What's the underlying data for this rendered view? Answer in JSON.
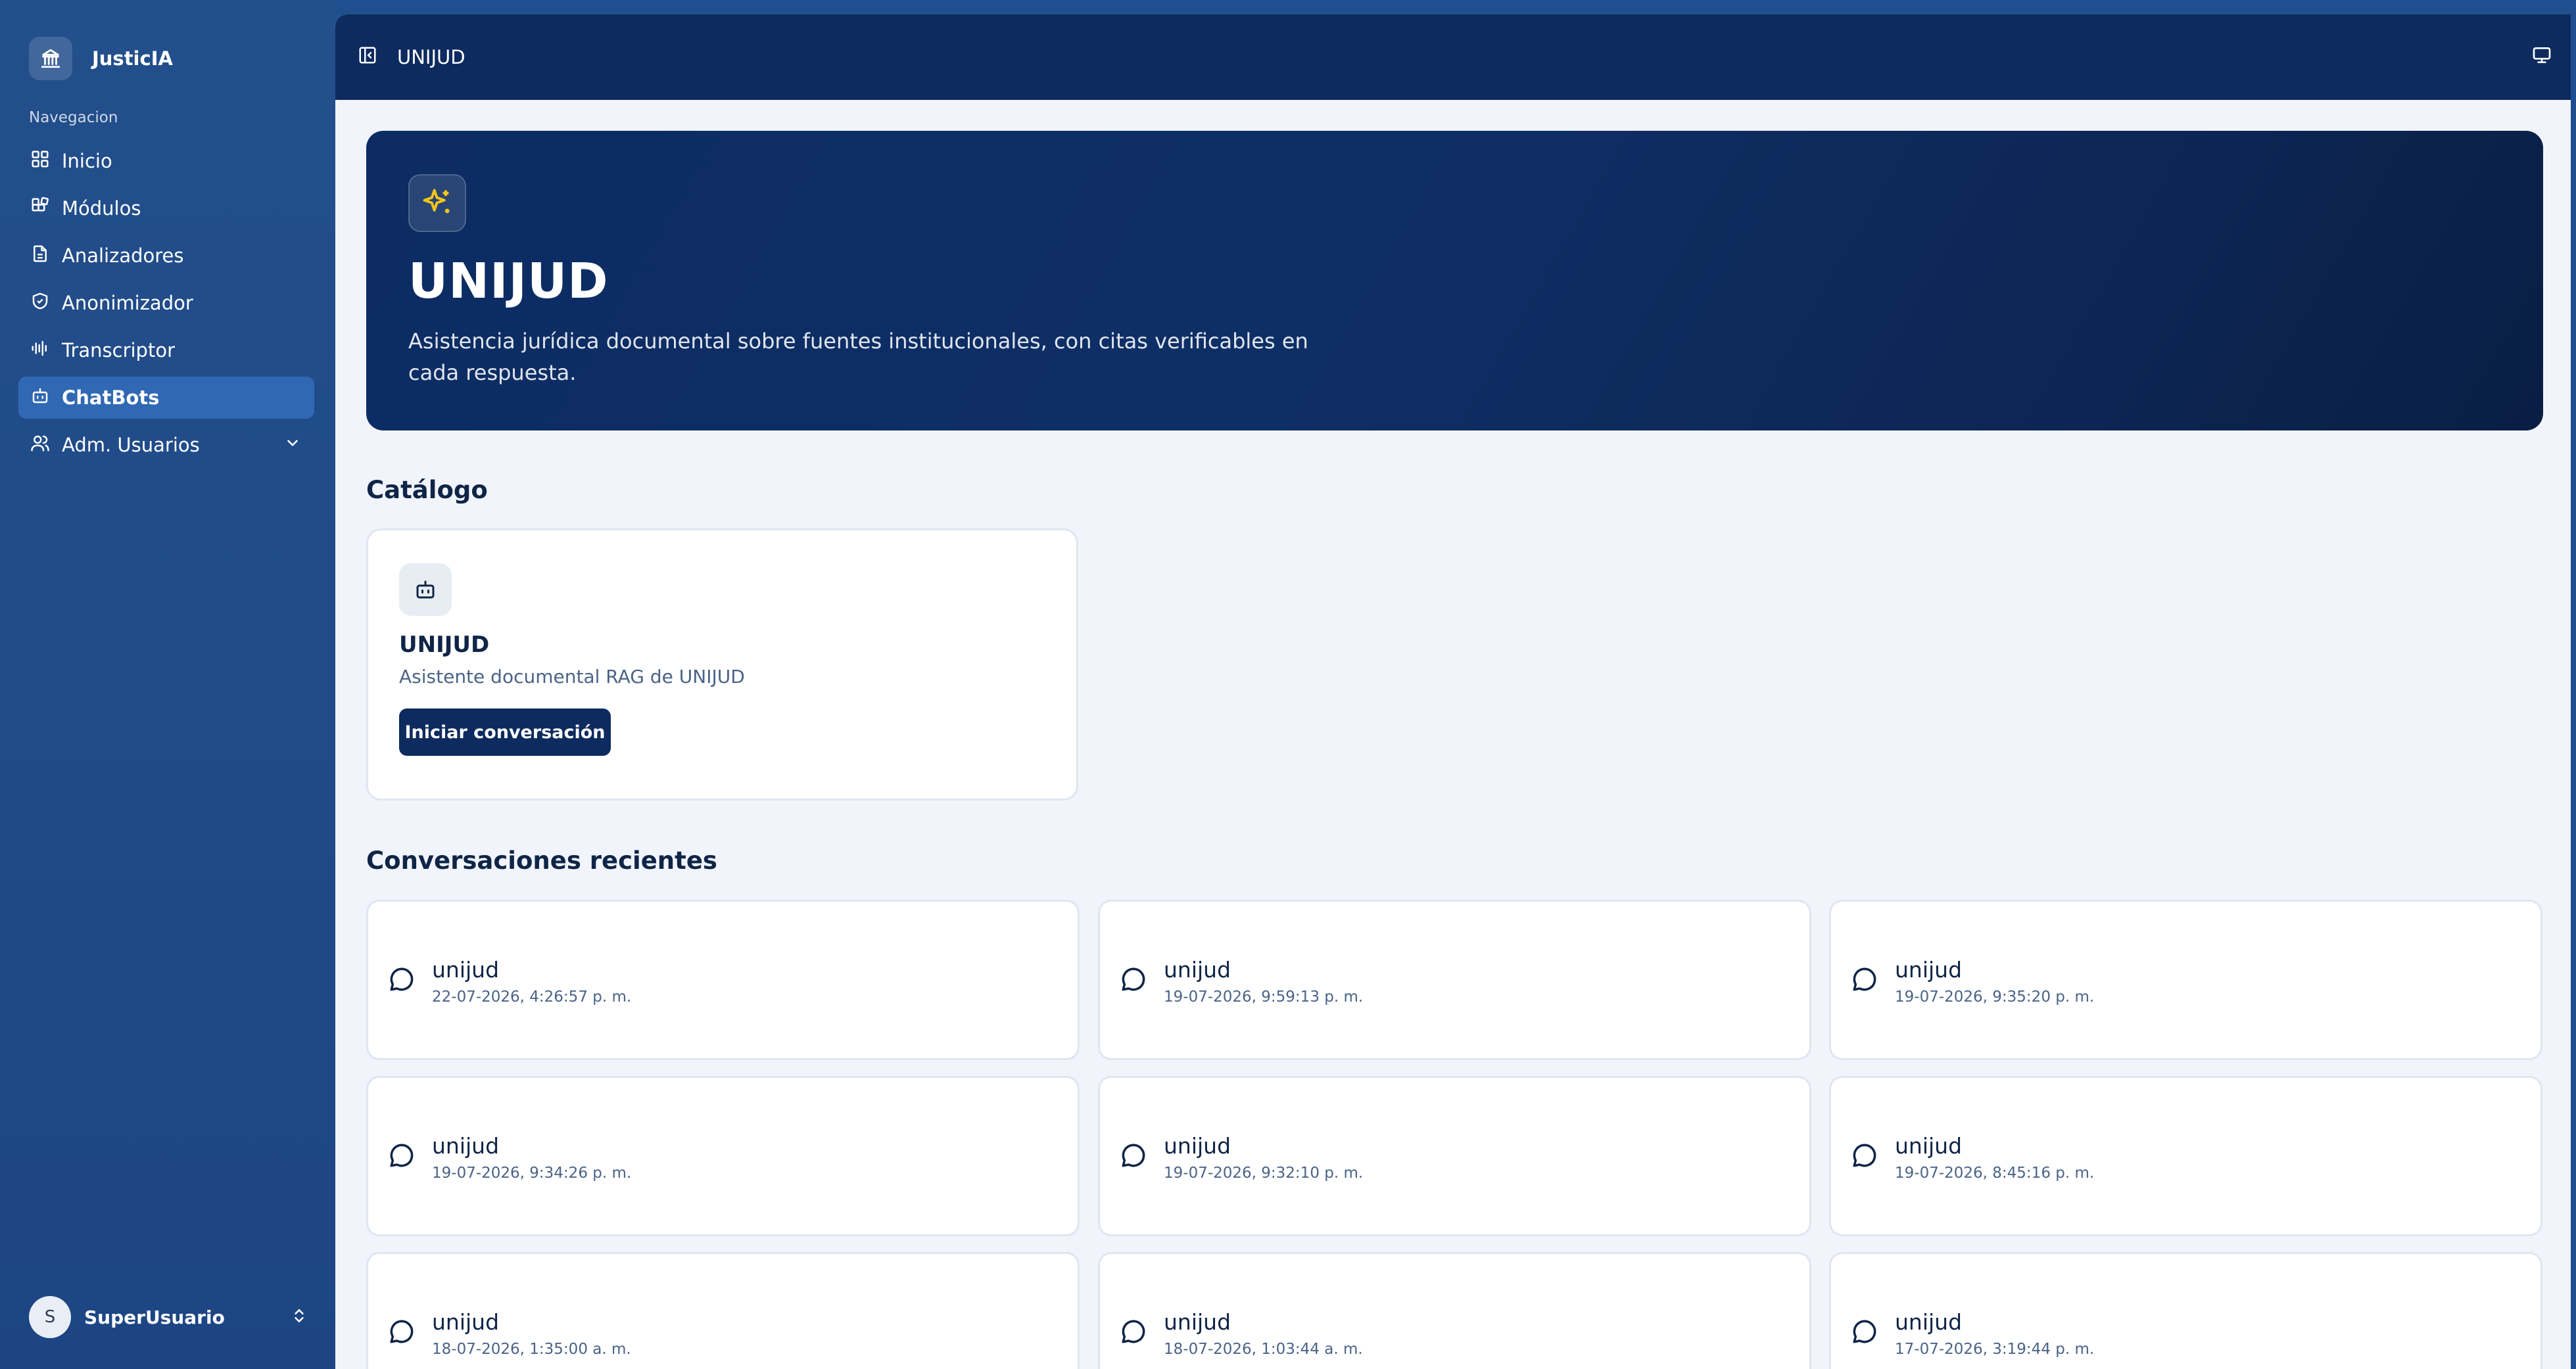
{
  "app": {
    "name": "JusticIA",
    "logo_icon": "bank-icon"
  },
  "sidebar": {
    "section_title": "Navegacion",
    "items": [
      {
        "label": "Inicio",
        "icon": "grid-icon"
      },
      {
        "label": "Módulos",
        "icon": "blocks-icon"
      },
      {
        "label": "Analizadores",
        "icon": "document-icon"
      },
      {
        "label": "Anonimizador",
        "icon": "shield-icon"
      },
      {
        "label": "Transcriptor",
        "icon": "audio-waveform-icon"
      },
      {
        "label": "ChatBots",
        "icon": "bot-icon",
        "active": true
      },
      {
        "label": "Adm. Usuarios",
        "icon": "users-icon",
        "expandable": true
      }
    ],
    "user": {
      "initial": "S",
      "name": "SuperUsuario"
    }
  },
  "topbar": {
    "title": "UNIJUD"
  },
  "hero": {
    "icon": "sparkles-icon",
    "title": "UNIJUD",
    "description": "Asistencia jurídica documental sobre fuentes institucionales, con citas verificables en cada respuesta."
  },
  "catalog": {
    "section_title": "Catálogo",
    "card": {
      "icon": "bot-icon",
      "name": "UNIJUD",
      "description": "Asistente documental RAG de UNIJUD",
      "button_label": "Iniciar conversación"
    }
  },
  "recent": {
    "section_title": "Conversaciones recientes",
    "conversations": [
      {
        "name": "unijud",
        "date": "22-07-2026, 4:26:57 p. m."
      },
      {
        "name": "unijud",
        "date": "19-07-2026, 9:59:13 p. m."
      },
      {
        "name": "unijud",
        "date": "19-07-2026, 9:35:20 p. m."
      },
      {
        "name": "unijud",
        "date": "19-07-2026, 9:34:26 p. m."
      },
      {
        "name": "unijud",
        "date": "19-07-2026, 9:32:10 p. m."
      },
      {
        "name": "unijud",
        "date": "19-07-2026, 8:45:16 p. m."
      },
      {
        "name": "unijud",
        "date": "18-07-2026, 1:35:00 a. m."
      },
      {
        "name": "unijud",
        "date": "18-07-2026, 1:03:44 a. m."
      },
      {
        "name": "unijud",
        "date": "17-07-2026, 3:19:44 p. m."
      }
    ]
  },
  "colors": {
    "sidebar_bg": "#234f8c",
    "topbar_bg": "#0d2b5e",
    "active_item": "#3068b3",
    "accent_sparkle": "#f5c518"
  }
}
